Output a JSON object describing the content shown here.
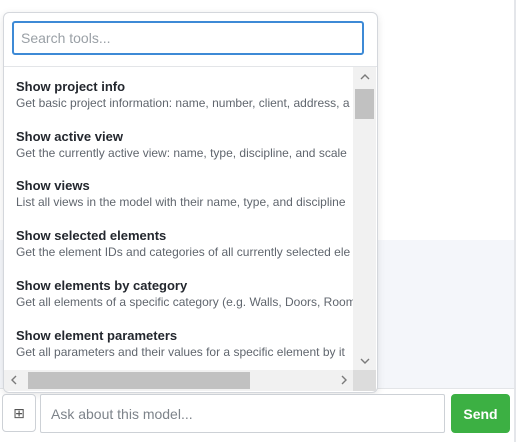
{
  "popup": {
    "search_placeholder": "Search tools...",
    "tools": [
      {
        "name": "Show project info",
        "description": "Get basic project information: name, number, client, address, a"
      },
      {
        "name": "Show active view",
        "description": "Get the currently active view: name, type, discipline, and scale"
      },
      {
        "name": "Show views",
        "description": "List all views in the model with their name, type, and discipline"
      },
      {
        "name": "Show selected elements",
        "description": "Get the element IDs and categories of all currently selected ele"
      },
      {
        "name": "Show elements by category",
        "description": "Get all elements of a specific category (e.g. Walls, Doors, Room"
      },
      {
        "name": "Show element parameters",
        "description": "Get all parameters and their values for a specific element by it"
      }
    ],
    "scrollbar": {
      "up_icon": "chevron-up-icon",
      "down_icon": "chevron-down-icon",
      "left_icon": "chevron-left-icon",
      "right_icon": "chevron-right-icon"
    }
  },
  "input_bar": {
    "tools_icon": "grid-icon",
    "tools_glyph": "⊞",
    "chat_placeholder": "Ask about this model...",
    "send_label": "Send"
  },
  "colors": {
    "accent": "#3d8ad6",
    "send": "#3cb043"
  }
}
